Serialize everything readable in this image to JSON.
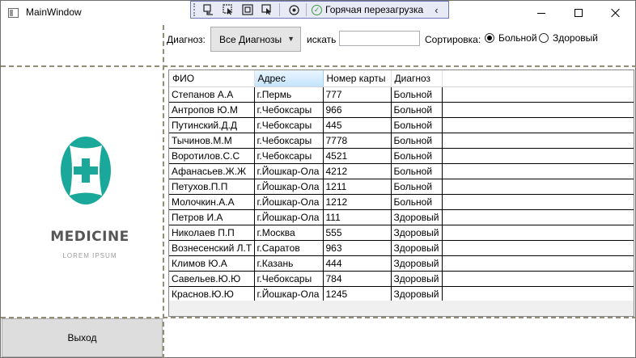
{
  "window": {
    "title": "MainWindow"
  },
  "dev_toolbar": {
    "hot_reload_label": "Горячая перезагрузка"
  },
  "filters": {
    "diagnosis_label": "Диагноз:",
    "diagnosis_selected": "Все Диагнозы",
    "search_label": "искать",
    "search_value": "",
    "sort_label": "Сортировка:",
    "sort_options": [
      "Больной",
      "Здоровый"
    ],
    "sort_selected": "Больной"
  },
  "logo": {
    "title": "MEDICINE",
    "subtitle": "LOREM IPSUM",
    "color": "#1aa89a"
  },
  "exit_button": "Выход",
  "table": {
    "columns": [
      "ФИО",
      "Адрес",
      "Номер карты",
      "Диагноз"
    ],
    "sorted_column": "Адрес",
    "rows": [
      [
        "Степанов А.А",
        "г.Пермь",
        "777",
        "Больной"
      ],
      [
        "Антропов Ю.М",
        "г.Чебоксары",
        "966",
        "Больной"
      ],
      [
        "Путинский.Д.Д",
        "г.Чебоксары",
        "445",
        "Больной"
      ],
      [
        "Тычинов.М.М",
        "г.Чебоксары",
        "7778",
        "Больной"
      ],
      [
        "Воротилов.С.С",
        "г.Чебоксары",
        "4521",
        "Больной"
      ],
      [
        "Афанасьев.Ж.Ж",
        "г.Йошкар-Ола",
        "4212",
        "Больной"
      ],
      [
        "Петухов.П.П",
        "г.Йошкар-Ола",
        "1211",
        "Больной"
      ],
      [
        "Молочкин.А.А",
        "г.Йошкар-Ола",
        "1212",
        "Больной"
      ],
      [
        "Петров И.А",
        "г.Йошкар-Ола",
        "111",
        "Здоровый"
      ],
      [
        "Николаев П.П",
        "г.Москва",
        "555",
        "Здоровый"
      ],
      [
        "Вознесенский Л.Т",
        "г.Саратов",
        "963",
        "Здоровый"
      ],
      [
        "Климов Ю.А",
        "г.Казань",
        "444",
        "Здоровый"
      ],
      [
        "Савельев.Ю.Ю",
        "г.Чебоксары",
        "784",
        "Здоровый"
      ],
      [
        "Краснов.Ю.Ю",
        "г.Йошкар-Ола",
        "1245",
        "Здоровый"
      ]
    ]
  }
}
